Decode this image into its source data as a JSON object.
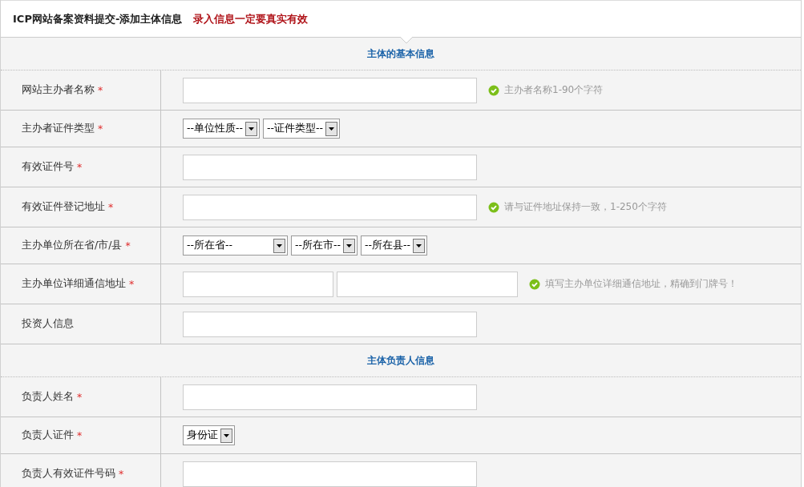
{
  "header": {
    "title": "ICP网站备案资料提交-添加主体信息",
    "notice": "录入信息一定要真实有效"
  },
  "sections": [
    {
      "title": "主体的基本信息",
      "rows": [
        {
          "label": "网站主办者名称",
          "required_mark": "*",
          "controls": [
            {
              "kind": "text"
            }
          ],
          "hint": "主办者名称1-90个字符"
        },
        {
          "label": "主办者证件类型",
          "required_mark": "*",
          "controls": [
            {
              "kind": "select",
              "value": "--单位性质--"
            },
            {
              "kind": "select",
              "value": "--证件类型--"
            }
          ]
        },
        {
          "label": "有效证件号",
          "required_mark": "*",
          "controls": [
            {
              "kind": "text"
            }
          ]
        },
        {
          "label": "有效证件登记地址",
          "required_mark": "*",
          "controls": [
            {
              "kind": "text"
            }
          ],
          "hint": "请与证件地址保持一致，1-250个字符"
        },
        {
          "label": "主办单位所在省/市/县",
          "required_mark": "*",
          "controls": [
            {
              "kind": "select-wide",
              "value": "--所在省--"
            },
            {
              "kind": "select",
              "value": "--所在市--"
            },
            {
              "kind": "select",
              "value": "--所在县--"
            }
          ]
        },
        {
          "label": "主办单位详细通信地址",
          "required_mark": "*",
          "controls": [
            {
              "kind": "text-short"
            },
            {
              "kind": "text-medium"
            }
          ],
          "hint": "填写主办单位详细通信地址，精确到门牌号！"
        },
        {
          "label": "投资人信息",
          "controls": [
            {
              "kind": "text"
            }
          ]
        }
      ]
    },
    {
      "title": "主体负责人信息",
      "rows": [
        {
          "label": "负责人姓名",
          "required_mark": "*",
          "controls": [
            {
              "kind": "text"
            }
          ]
        },
        {
          "label": "负责人证件",
          "required_mark": "*",
          "controls": [
            {
              "kind": "select",
              "value": "身份证"
            }
          ]
        },
        {
          "label": "负责人有效证件号码",
          "required_mark": "*",
          "controls": [
            {
              "kind": "text"
            }
          ]
        }
      ]
    }
  ]
}
